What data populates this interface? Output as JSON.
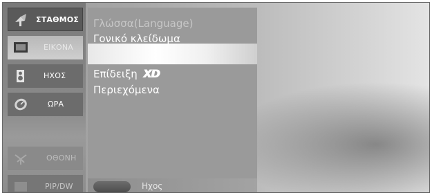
{
  "sidebar": {
    "items": [
      {
        "label": "ΣΤΑΘΜΟΣ",
        "icon": "satellite-dish-icon",
        "state": "selected"
      },
      {
        "label": "ΕΙΚΟΝΑ",
        "icon": "tv-screen-icon",
        "state": "highlighted"
      },
      {
        "label": "ΗΧΟΣ",
        "icon": "speaker-icon",
        "state": "normal"
      },
      {
        "label": "ΩΡΑ",
        "icon": "clock-icon",
        "state": "normal"
      },
      {
        "label": "ΟΘΟΝΗ",
        "icon": "screen-icon",
        "state": "dimmed"
      },
      {
        "label": "PIP/DW",
        "icon": "pip-icon",
        "state": "dimmed"
      }
    ]
  },
  "submenu": {
    "items": [
      {
        "label": "Γλώσσα(Language)"
      },
      {
        "label": "Γονικό κλείδωμα"
      },
      {
        "label": "Επίδειξη",
        "badge": "XD"
      },
      {
        "label": "Περιεχόμενα"
      }
    ],
    "bottom_label": "Ηχος"
  },
  "colors": {
    "panel": "#9a9a9a",
    "sidebar_selected": "#5a5a5a",
    "text": "#ffffff"
  }
}
